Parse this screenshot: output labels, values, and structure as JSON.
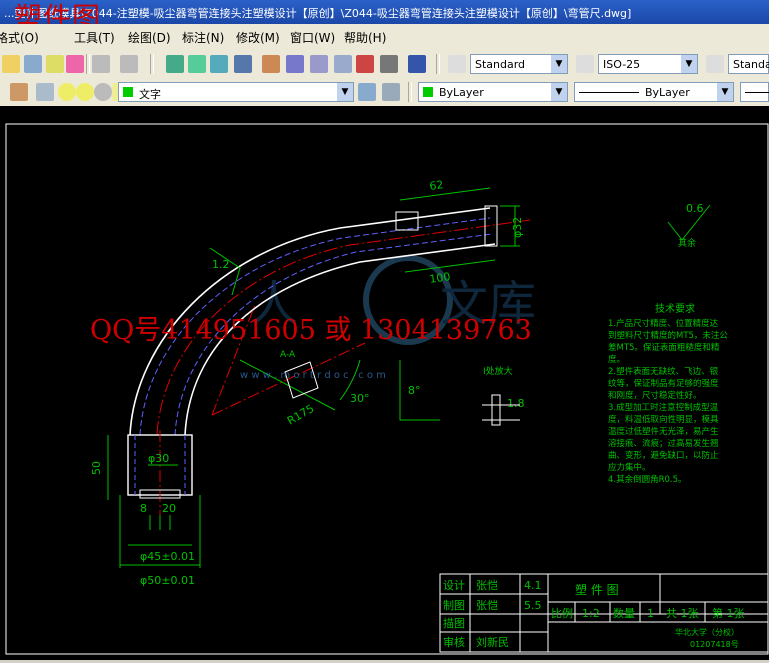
{
  "window": {
    "title": "...塑件图纸模具\\Z044-注塑模-吸尘器弯管连接头注塑模设计【原创】\\Z044-吸尘器弯管连接头注塑模设计【原创】\\弯管尺.dwg]",
    "watermark_top": "塑件图"
  },
  "menu": [
    "格式(O)",
    "工具(T)",
    "绘图(D)",
    "标注(N)",
    "修改(M)",
    "窗口(W)",
    "帮助(H)"
  ],
  "toolbar": {
    "text_style": "Standard",
    "dim_style": "ISO-25",
    "table_style": "Standa",
    "layer": "文字",
    "color": "ByLayer",
    "linetype": "ByLayer"
  },
  "overlay": {
    "qq": "QQ号414951605 或 1304139763",
    "site": "w w w . m o r t r d o c . c o m"
  },
  "drawing": {
    "dims": {
      "d62": "62",
      "d100": "100",
      "dR175": "R175",
      "d30": "30°",
      "d8": "8°",
      "d50": "50",
      "d30s": "φ30",
      "d8b": "8",
      "d20": "20",
      "d45": "φ45±0.01",
      "d50b": "φ50±0.01",
      "d06": "0.6",
      "d18": "1.8",
      "d32": "φ32",
      "d12": "1.2",
      "rest": "其余",
      "detail": "I处放大",
      "sectionA": "A-A"
    },
    "tech_title": "技术要求",
    "tech_lines": [
      "1.产品尺寸精度、位置精度达",
      "到塑料尺寸精度的MT5，未注公",
      "差MT5。保证表面粗糙度和精",
      "度。",
      "2.塑件表面无缺纹、飞边、银",
      "纹等，保证制品有足够的强度",
      "和刚度，尺寸稳定性好。",
      "3.成型加工时注意控制成型温",
      "度，料温低取向性明显，模具",
      "温度过低塑件无光泽，易产生",
      "溶接痕、流痕；过高易发生翘",
      "曲、变形，避免缺口，以防止",
      "应力集中。",
      "4.其余倒圆角R0.5。"
    ]
  },
  "titleblock": {
    "design_label": "设计",
    "design_name": "张恺",
    "design_v": "4.1",
    "draw_label": "制图",
    "draw_name": "张恺",
    "draw_v": "5.5",
    "trace_label": "描图",
    "check_label": "审核",
    "check_name": "刘新民",
    "part_name": "塑 件 图",
    "scale_label": "比例",
    "scale": "1:2",
    "qty_label": "数量",
    "qty": "1",
    "sheets_total": "共 1张",
    "sheet_no": "第 1张",
    "school": "华北大学（分校）",
    "code": "01207418号"
  },
  "colors": {
    "bg": "#000000",
    "outline": "#ffffff",
    "dim": "#00c000",
    "center": "#e00000",
    "hidden": "#6060ff"
  }
}
